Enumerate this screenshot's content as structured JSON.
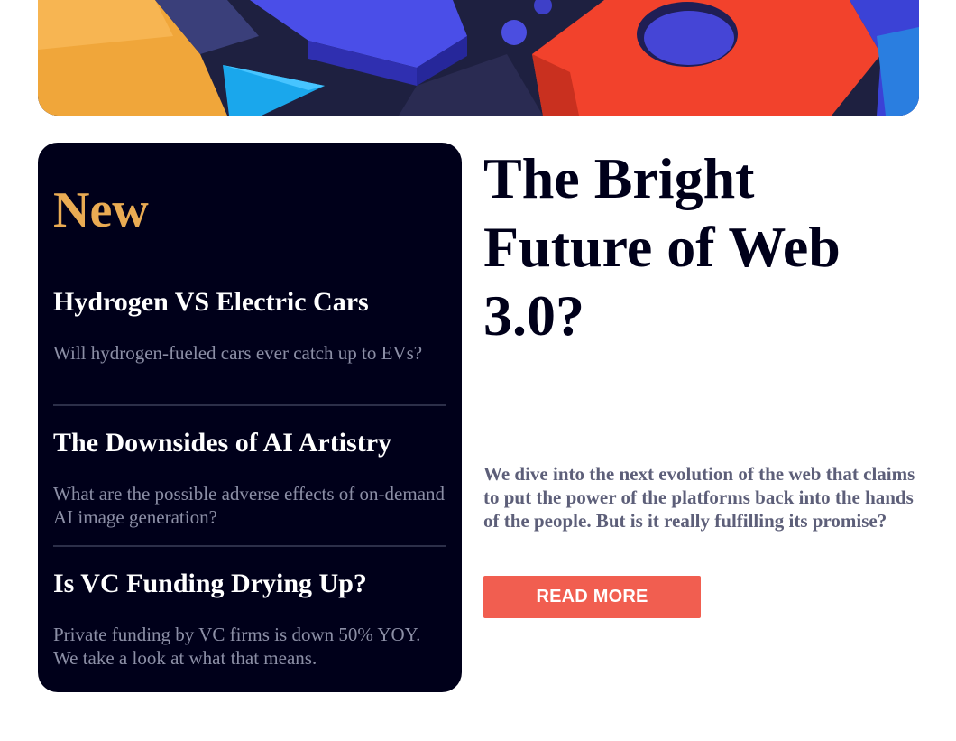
{
  "hero": {
    "image_name": "abstract-3d-shapes-image"
  },
  "new_panel": {
    "title": "New",
    "items": [
      {
        "title": "Hydrogen VS Electric Cars",
        "summary": "Will hydrogen-fueled cars ever catch up to EVs?"
      },
      {
        "title": "The Downsides of AI Artistry",
        "summary": "What are the possible adverse effects of on-demand AI image generation?"
      },
      {
        "title": "Is VC Funding Drying Up?",
        "summary": "Private funding by VC firms is down 50% YOY. We take a look at what that means."
      }
    ]
  },
  "main": {
    "headline": "The Bright Future of Web 3.0?",
    "lede": "We dive into the next evolution of the web that claims to put the power of the platforms back into the hands of the people. But is it really fulfilling its promise?",
    "read_more_label": "READ MORE"
  },
  "colors": {
    "panel_bg": "#00001a",
    "accent_orange": "#e9ab53",
    "button_red": "#f15e50",
    "muted_text": "#8c8fa6",
    "lede_text": "#5d5f79"
  }
}
